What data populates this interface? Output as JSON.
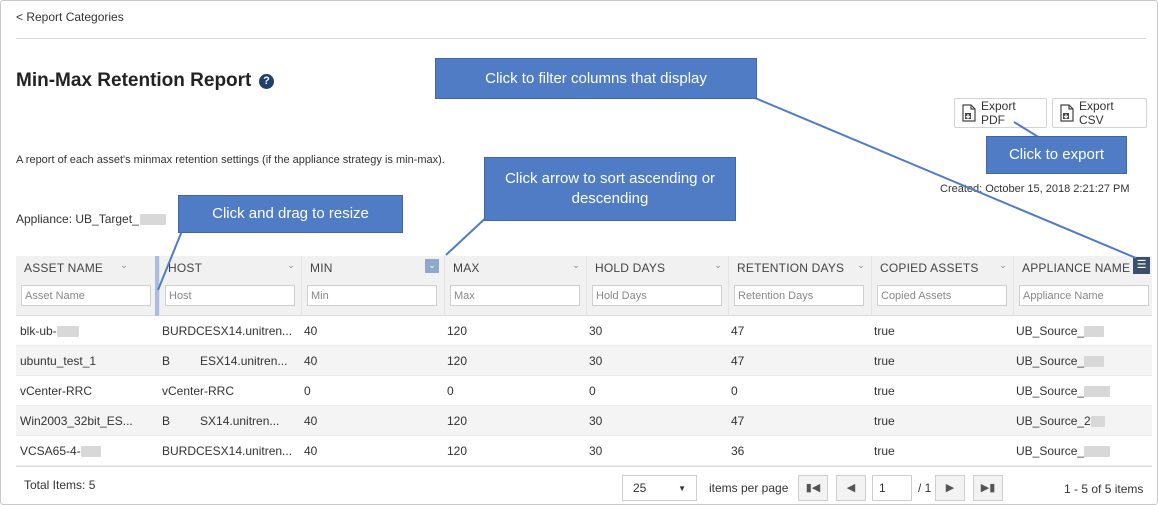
{
  "nav": {
    "back_label": "< Report Categories"
  },
  "page": {
    "title": "Min-Max Retention Report",
    "help_icon": "question-circle-icon",
    "description": "A report of each asset's minmax retention settings (if the appliance strategy is min-max).",
    "appliance_label": "Appliance: UB_Target_",
    "created": "Created: October 15, 2018 2:21:27 PM"
  },
  "toolbar": {
    "export_pdf_label": "Export PDF",
    "export_csv_label": "Export CSV"
  },
  "callouts": {
    "filter": "Click to filter columns that display",
    "export": "Click to export",
    "sort": "Click arrow to sort ascending or descending",
    "resize": "Click and drag to resize"
  },
  "columns": [
    {
      "title": "ASSET NAME",
      "placeholder": "Asset Name"
    },
    {
      "title": "HOST",
      "placeholder": "Host"
    },
    {
      "title": "MIN",
      "placeholder": "Min"
    },
    {
      "title": "MAX",
      "placeholder": "Max"
    },
    {
      "title": "HOLD DAYS",
      "placeholder": "Hold Days"
    },
    {
      "title": "RETENTION DAYS",
      "placeholder": "Retention Days"
    },
    {
      "title": "COPIED ASSETS",
      "placeholder": "Copied Assets"
    },
    {
      "title": "APPLIANCE NAME",
      "placeholder": "Appliance Name"
    }
  ],
  "rows": [
    {
      "asset": "blk-ub-",
      "host": "BURDCESX14.unitren...",
      "min": "40",
      "max": "120",
      "hold": "30",
      "retention": "47",
      "copied": "true",
      "appliance": "UB_Source_"
    },
    {
      "asset": "ubuntu_test_1",
      "host": "B         ESX14.unitren...",
      "min": "40",
      "max": "120",
      "hold": "30",
      "retention": "47",
      "copied": "true",
      "appliance": "UB_Source_"
    },
    {
      "asset": "vCenter-RRC",
      "host": "vCenter-RRC",
      "min": "0",
      "max": "0",
      "hold": "0",
      "retention": "0",
      "copied": "true",
      "appliance": "UB_Source_"
    },
    {
      "asset": "Win2003_32bit_ES...",
      "host": "B         SX14.unitren...",
      "min": "40",
      "max": "120",
      "hold": "30",
      "retention": "47",
      "copied": "true",
      "appliance": "UB_Source_2"
    },
    {
      "asset": "VCSA65-4-",
      "host": "BURDCESX14.unitren...",
      "min": "40",
      "max": "120",
      "hold": "30",
      "retention": "36",
      "copied": "true",
      "appliance": "UB_Source_"
    }
  ],
  "footer": {
    "total": "Total Items: 5",
    "page_size": "25",
    "items_per_page": "items per page",
    "current_page": "1",
    "of_pages": "/ 1",
    "range": "1 - 5 of 5 items"
  },
  "colors": {
    "callout": "#4f7cc4",
    "header_bg": "#f1f1f1",
    "row_alt": "#f4f4f4",
    "menu_button": "#3b4f6c"
  }
}
